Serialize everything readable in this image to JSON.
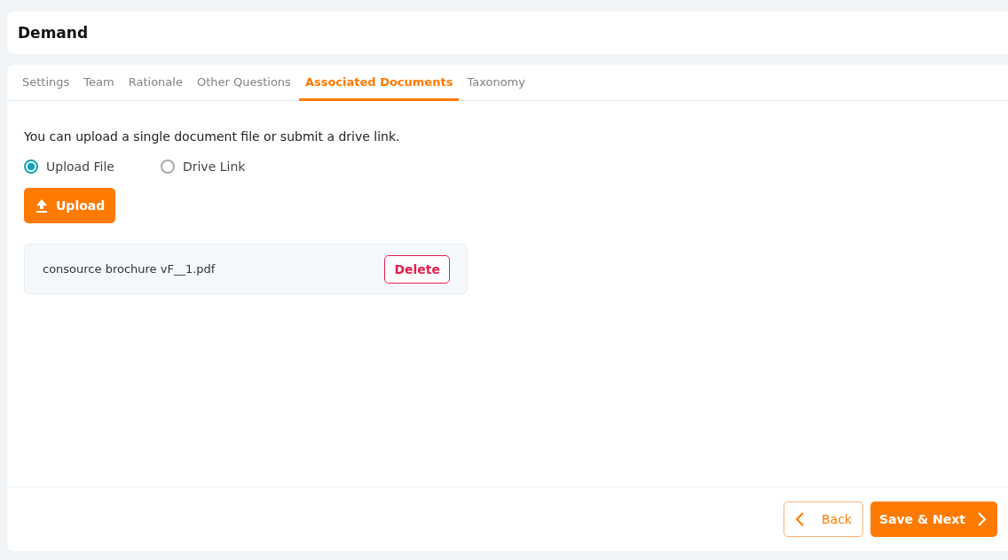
{
  "header": {
    "title": "Demand"
  },
  "tabs": [
    {
      "label": "Settings",
      "selected": false
    },
    {
      "label": "Team",
      "selected": false
    },
    {
      "label": "Rationale",
      "selected": false
    },
    {
      "label": "Other Questions",
      "selected": false
    },
    {
      "label": "Associated Documents",
      "selected": true
    },
    {
      "label": "Taxonomy",
      "selected": false
    }
  ],
  "instructions": "You can upload a single document file or submit a drive link.",
  "options": [
    {
      "label": "Upload File",
      "selected": true
    },
    {
      "label": "Drive Link",
      "selected": false
    }
  ],
  "upload_button": "Upload",
  "files": [
    {
      "name": "consource brochure vF__1.pdf",
      "action": "Delete"
    }
  ],
  "footer": {
    "back": "Back",
    "next": "Save & Next"
  }
}
